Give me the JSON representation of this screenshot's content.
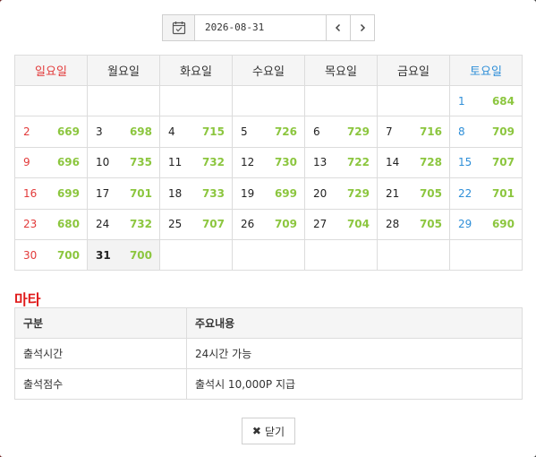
{
  "date_nav": {
    "date_value": "2026-08-31",
    "prev_icon": "chevron-left-icon",
    "next_icon": "chevron-right-icon",
    "calendar_icon": "calendar-check-icon"
  },
  "calendar": {
    "weekdays": [
      "일요일",
      "월요일",
      "화요일",
      "수요일",
      "목요일",
      "금요일",
      "토요일"
    ],
    "weeks": [
      [
        null,
        null,
        null,
        null,
        null,
        null,
        {
          "day": "1",
          "value": "684"
        }
      ],
      [
        {
          "day": "2",
          "value": "669"
        },
        {
          "day": "3",
          "value": "698"
        },
        {
          "day": "4",
          "value": "715"
        },
        {
          "day": "5",
          "value": "726"
        },
        {
          "day": "6",
          "value": "729"
        },
        {
          "day": "7",
          "value": "716"
        },
        {
          "day": "8",
          "value": "709"
        }
      ],
      [
        {
          "day": "9",
          "value": "696"
        },
        {
          "day": "10",
          "value": "735"
        },
        {
          "day": "11",
          "value": "732"
        },
        {
          "day": "12",
          "value": "730"
        },
        {
          "day": "13",
          "value": "722"
        },
        {
          "day": "14",
          "value": "728"
        },
        {
          "day": "15",
          "value": "707"
        }
      ],
      [
        {
          "day": "16",
          "value": "699"
        },
        {
          "day": "17",
          "value": "701"
        },
        {
          "day": "18",
          "value": "733"
        },
        {
          "day": "19",
          "value": "699"
        },
        {
          "day": "20",
          "value": "729"
        },
        {
          "day": "21",
          "value": "705"
        },
        {
          "day": "22",
          "value": "701"
        }
      ],
      [
        {
          "day": "23",
          "value": "680"
        },
        {
          "day": "24",
          "value": "732"
        },
        {
          "day": "25",
          "value": "707"
        },
        {
          "day": "26",
          "value": "709"
        },
        {
          "day": "27",
          "value": "704"
        },
        {
          "day": "28",
          "value": "705"
        },
        {
          "day": "29",
          "value": "690"
        }
      ],
      [
        {
          "day": "30",
          "value": "700"
        },
        {
          "day": "31",
          "value": "700",
          "today": true
        },
        null,
        null,
        null,
        null,
        null
      ]
    ],
    "colors": {
      "sunday": "#e23a3a",
      "saturday": "#2f8fd8",
      "value": "#8cc63f"
    }
  },
  "etc": {
    "title": "마타",
    "headers": [
      "구분",
      "주요내용"
    ],
    "rows": [
      [
        "출석시간",
        "24시간 가능"
      ],
      [
        "출석점수",
        "출석시 10,000P 지급"
      ]
    ]
  },
  "close_button": {
    "label": "닫기",
    "icon": "close-icon"
  }
}
